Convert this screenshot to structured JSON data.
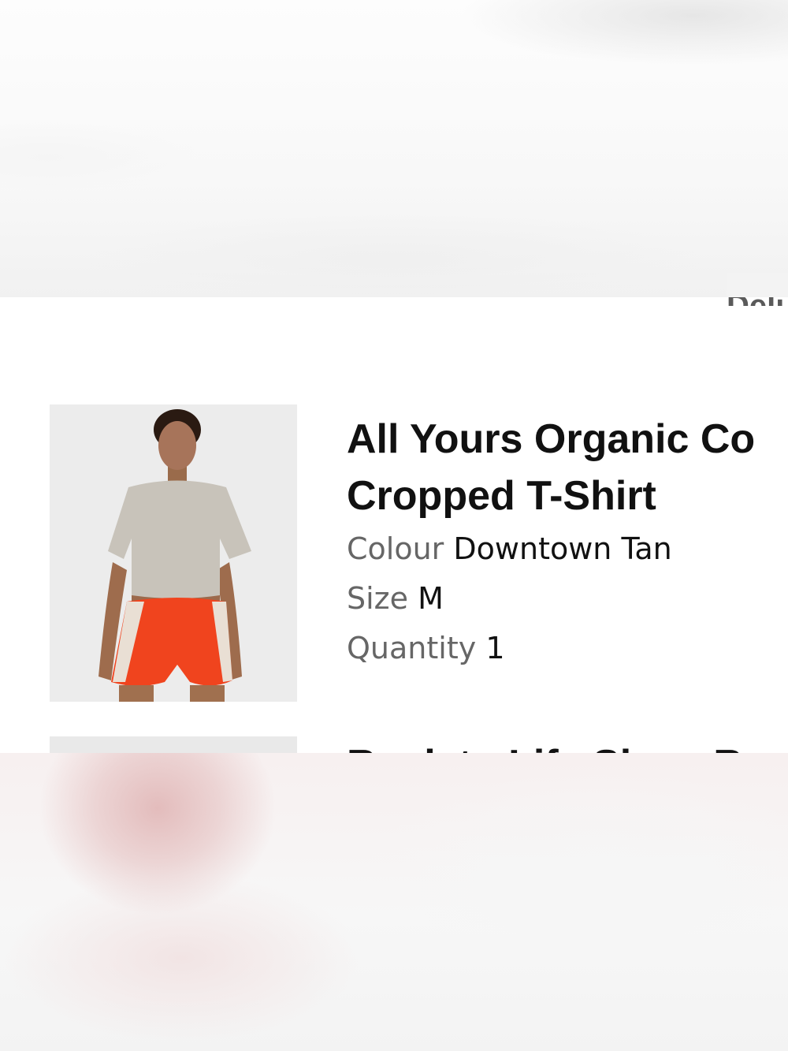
{
  "header": {
    "cut_text": "Deli"
  },
  "cart_item": {
    "title_line1": "All Yours Organic Co",
    "title_line2": "Cropped T-Shirt",
    "colour_label": "Colour",
    "colour_value": "Downtown Tan",
    "size_label": "Size",
    "size_value": "M",
    "quantity_label": "Quantity",
    "quantity_value": "1",
    "image_desc_colors": {
      "shirt": "#c8c3ba",
      "shorts": "#f0441e",
      "background": "#ececec"
    }
  },
  "next_item": {
    "title_partial": "Rock to Life Sleep R"
  }
}
